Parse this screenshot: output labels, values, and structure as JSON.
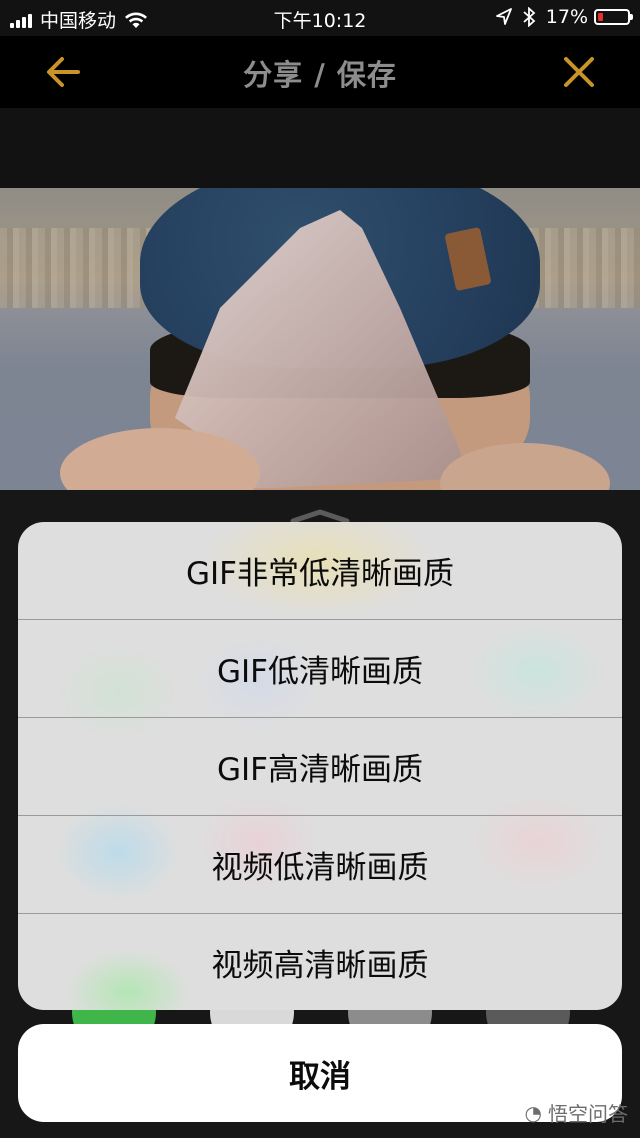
{
  "status_bar": {
    "carrier": "中国移动",
    "time": "下午10:12",
    "battery_percent": "17%",
    "battery_level": 0.17,
    "battery_color": "#e5322d",
    "icons": [
      "signal-icon",
      "wifi-icon",
      "location-icon",
      "bluetooth-icon",
      "battery-icon"
    ]
  },
  "nav": {
    "title": "分享 / 保存",
    "back_icon": "arrow-left-icon",
    "close_icon": "close-icon",
    "accent_color": "#c8942a"
  },
  "action_sheet": {
    "options": [
      "GIF非常低清晰画质",
      "GIF低清晰画质",
      "GIF高清晰画质",
      "视频低清晰画质",
      "视频高清晰画质"
    ],
    "cancel_label": "取消"
  },
  "watermark": {
    "text": "悟空问答"
  }
}
